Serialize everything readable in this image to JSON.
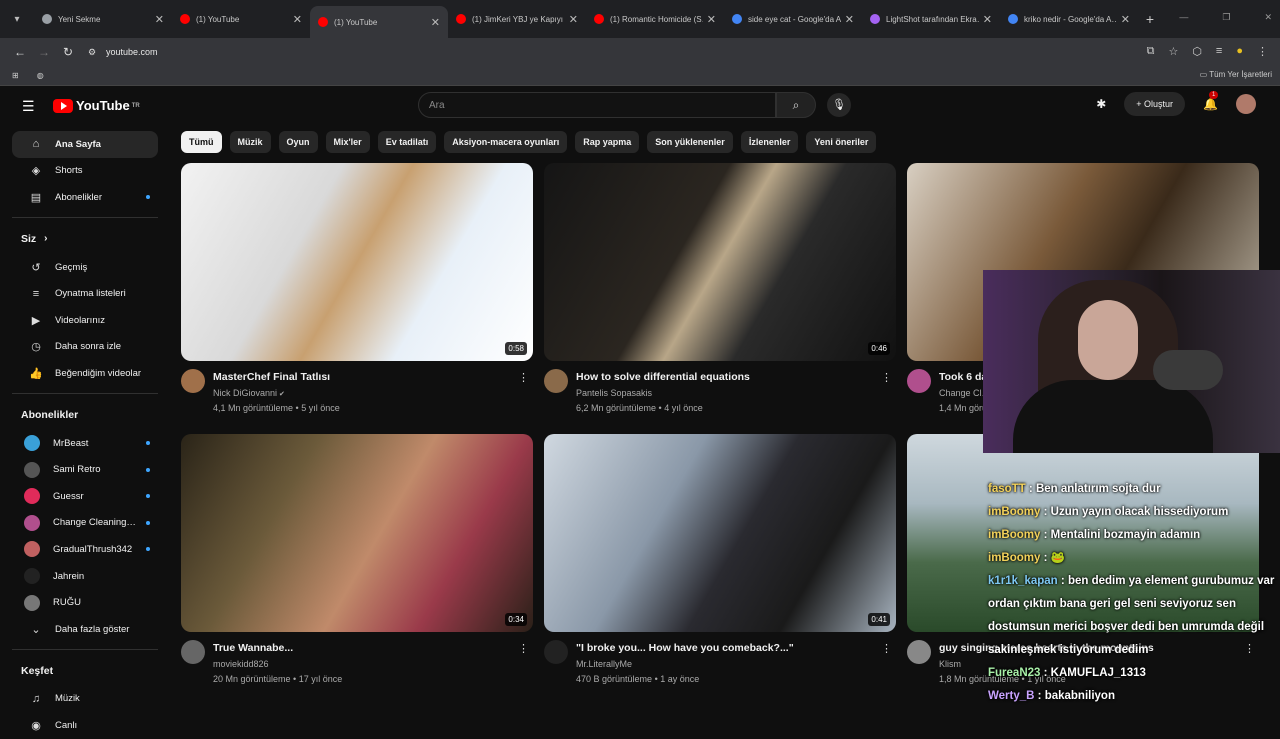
{
  "browser": {
    "tabs": [
      {
        "title": "Yeni Sekme",
        "color": "#9aa0a6"
      },
      {
        "title": "(1) YouTube",
        "color": "#ff0000"
      },
      {
        "title": "(1) YouTube",
        "color": "#ff0000"
      },
      {
        "title": "(1) JimKeri YBJ ye Kapıyı G…",
        "color": "#ff0000"
      },
      {
        "title": "(1) Romantic Homicide (S…",
        "color": "#ff0000"
      },
      {
        "title": "side eye cat - Google'da A…",
        "color": "#4285f4"
      },
      {
        "title": "LightShot tarafından Ekra…",
        "color": "#a463f2"
      },
      {
        "title": "kriko nedir - Google'da A…",
        "color": "#4285f4"
      }
    ],
    "active_tab_index": 2,
    "url": "youtube.com",
    "bookmarks_label": "Tüm Yer İşaretleri"
  },
  "youtube": {
    "logo_text": "YouTube",
    "logo_region": "TR",
    "search_placeholder": "Ara",
    "create_label": "Oluştur",
    "notification_count": "1"
  },
  "sidebar": {
    "main": [
      {
        "label": "Ana Sayfa",
        "icon": "home-icon",
        "glyph": "⌂"
      },
      {
        "label": "Shorts",
        "icon": "shorts-icon",
        "glyph": "◈"
      },
      {
        "label": "Abonelikler",
        "icon": "subscriptions-icon",
        "glyph": "▤"
      }
    ],
    "you_heading": "Siz",
    "you": [
      {
        "label": "Geçmiş",
        "icon": "history-icon",
        "glyph": "↺"
      },
      {
        "label": "Oynatma listeleri",
        "icon": "playlist-icon",
        "glyph": "≡"
      },
      {
        "label": "Videolarınız",
        "icon": "your-videos-icon",
        "glyph": "▶"
      },
      {
        "label": "Daha sonra izle",
        "icon": "watch-later-icon",
        "glyph": "◷"
      },
      {
        "label": "Beğendiğim videolar",
        "icon": "like-icon",
        "glyph": "👍"
      }
    ],
    "subs_heading": "Abonelikler",
    "subscriptions": [
      {
        "label": "MrBeast",
        "color": "#3aa0d8"
      },
      {
        "label": "Sami Retro",
        "color": "#555"
      },
      {
        "label": "Guessr",
        "color": "#e02b5a"
      },
      {
        "label": "Change Cleaning…",
        "color": "#b04f8d"
      },
      {
        "label": "GradualThrush342",
        "color": "#c06060"
      },
      {
        "label": "Jahrein",
        "color": "#222"
      },
      {
        "label": "RUĞU",
        "color": "#777"
      }
    ],
    "show_more": "Daha fazla göster",
    "explore_heading": "Keşfet",
    "explore": [
      {
        "label": "Müzik",
        "icon": "music-icon",
        "glyph": "♫"
      },
      {
        "label": "Canlı",
        "icon": "live-icon",
        "glyph": "◉"
      }
    ]
  },
  "chips": [
    "Tümü",
    "Müzik",
    "Oyun",
    "Mix'ler",
    "Ev tadilatı",
    "Aksiyon-macera oyunları",
    "Rap yapma",
    "Son yüklenenler",
    "İzlenenler",
    "Yeni öneriler"
  ],
  "videos": [
    {
      "title": "MasterChef Final Tatlısı",
      "channel": "Nick DiGiovanni",
      "verified": true,
      "views": "4,1 Mn görüntüleme",
      "age": "5 yıl önce",
      "duration": "0:58",
      "thumb": "linear-gradient(120deg,#f2f2f2 0%,#d9d9d9 35%,#c8a070 50%,#e8f0f8 70%,#ffffff 100%)",
      "avatar": "#a0704a"
    },
    {
      "title": "How to solve differential equations",
      "channel": "Pantelis Sopasakis",
      "verified": false,
      "views": "6,2 Mn görüntüleme",
      "age": "4 yıl önce",
      "duration": "0:46",
      "thumb": "linear-gradient(120deg,#151515 0%,#2b2620 40%,#b8a688 50%,#2a2a2a 65%,#111 100%)",
      "avatar": "#8a6a4a"
    },
    {
      "title": "Took 6 da…",
      "channel": "Change Cl…",
      "verified": false,
      "views": "1,4 Mn görüntüleme",
      "age": "",
      "duration": "",
      "thumb": "linear-gradient(120deg,#d8cfc2 0%,#7a5a3a 40%,#3a2a1a 60%,#c0b8a8 100%)",
      "avatar": "#b04f8d"
    },
    {
      "title": "True Wannabe...",
      "channel": "moviekidd826",
      "verified": false,
      "views": "20 Mn görüntüleme",
      "age": "17 yıl önce",
      "duration": "0:34",
      "thumb": "linear-gradient(120deg,#2a2418 0%,#6b5a3a 30%,#c08a6a 55%,#9a3a4a 75%,#2a2018 100%)",
      "avatar": "#666"
    },
    {
      "title": "\"I broke you... How have you comeback?...\"",
      "channel": "Mr.LiterallyMe",
      "verified": false,
      "views": "470 B görüntüleme",
      "age": "1 ay önce",
      "duration": "0:41",
      "thumb": "linear-gradient(120deg,#d0d8e0 0%,#8a98a8 35%,#2a2a30 55%,#1a1a1a 75%,#a8b4c0 100%)",
      "avatar": "#222"
    },
    {
      "title": "guy singing stereo hearts in the mountains",
      "channel": "Klism",
      "verified": false,
      "views": "1,8 Mn görüntüleme",
      "age": "1 yıl önce",
      "duration": "",
      "thumb": "linear-gradient(180deg,#cfd8de 0%,#a8b8c0 35%,#4a6a4a 65%,#2a4a2a 100%)",
      "avatar": "#888"
    }
  ],
  "overlay_chat": [
    {
      "user": "fasoTT",
      "msg": "Ben anlatırım sojta dur",
      "cls": "u"
    },
    {
      "user": "imBoomy",
      "msg": "Uzun yayın olacak hissediyorum",
      "cls": "u"
    },
    {
      "user": "imBoomy",
      "msg": "Mentalini bozmayin adamın",
      "cls": "u"
    },
    {
      "user": "imBoomy",
      "msg": "🐸",
      "cls": "u"
    },
    {
      "user": "k1r1k_kapan",
      "msg": "ben dedim ya element gurubumuz var ordan çıktım bana geri gel seni seviyoruz sen dostumsun merici boşver dedi ben umrumda değil sakinleşmek istiyorum dedim",
      "cls": "u2"
    },
    {
      "user": "FureaN23",
      "msg": "KAMUFLAJ_1313",
      "cls": "u3"
    },
    {
      "user": "Werty_B",
      "msg": "bakabniliyon",
      "cls": "u4"
    }
  ]
}
